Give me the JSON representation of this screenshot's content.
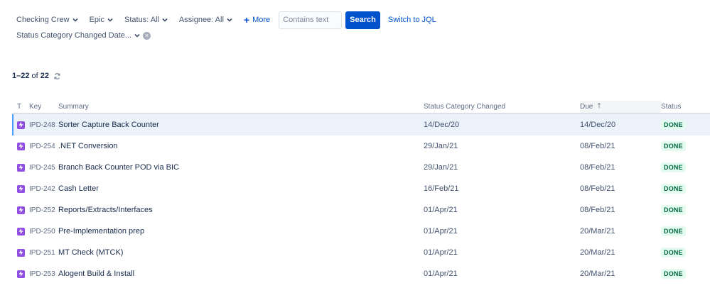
{
  "filters": [
    {
      "label": "Checking Crew"
    },
    {
      "label": "Epic"
    },
    {
      "label": "Status: All"
    },
    {
      "label": "Assignee: All"
    }
  ],
  "more_label": "More",
  "search": {
    "placeholder": "Contains text",
    "button_label": "Search"
  },
  "switch_jql_label": "Switch to JQL",
  "extra_filter_label": "Status Category Changed Date...",
  "results": {
    "range": "1–22",
    "of_word": "of",
    "total": "22"
  },
  "table": {
    "headers": {
      "type": "T",
      "key": "Key",
      "summary": "Summary",
      "status_changed": "Status Category Changed",
      "due": "Due",
      "status": "Status"
    },
    "rows": [
      {
        "key": "IPD-248",
        "summary": "Sorter Capture Back Counter",
        "status_changed": "14/Dec/20",
        "due": "14/Dec/20",
        "status": "DONE"
      },
      {
        "key": "IPD-254",
        "summary": ".NET Conversion",
        "status_changed": "29/Jan/21",
        "due": "08/Feb/21",
        "status": "DONE"
      },
      {
        "key": "IPD-245",
        "summary": "Branch Back Counter POD via BIC",
        "status_changed": "29/Jan/21",
        "due": "08/Feb/21",
        "status": "DONE"
      },
      {
        "key": "IPD-242",
        "summary": "Cash Letter",
        "status_changed": "16/Feb/21",
        "due": "08/Feb/21",
        "status": "DONE"
      },
      {
        "key": "IPD-252",
        "summary": "Reports/Extracts/Interfaces",
        "status_changed": "01/Apr/21",
        "due": "08/Feb/21",
        "status": "DONE"
      },
      {
        "key": "IPD-250",
        "summary": "Pre-Implementation prep",
        "status_changed": "01/Apr/21",
        "due": "20/Mar/21",
        "status": "DONE"
      },
      {
        "key": "IPD-251",
        "summary": "MT Check (MTCK)",
        "status_changed": "01/Apr/21",
        "due": "20/Mar/21",
        "status": "DONE"
      },
      {
        "key": "IPD-253",
        "summary": "Alogent Build & Install",
        "status_changed": "01/Apr/21",
        "due": "20/Mar/21",
        "status": "DONE"
      }
    ]
  },
  "colors": {
    "accent": "#0052cc",
    "epic_icon": "#904ee2",
    "done_bg": "#e3fcef",
    "done_text": "#006644"
  }
}
